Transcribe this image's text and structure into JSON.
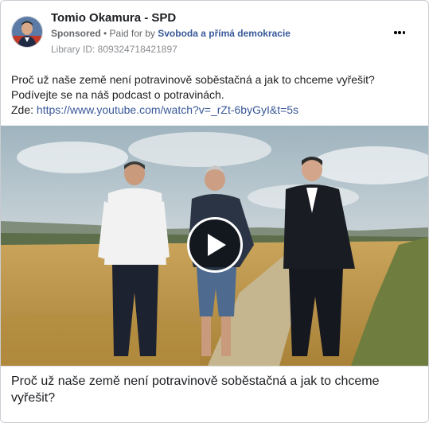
{
  "ad": {
    "page_name": "Tomio Okamura - SPD",
    "sponsored_label": "Sponsored",
    "paid_for_prefix": " • Paid for by ",
    "payer": "Svoboda a přímá demokracie",
    "library_id": "Library ID: 809324718421897"
  },
  "post": {
    "text": "Proč už naše země není potravinově soběstačná a jak to chceme vyřešit? Podívejte se na náš podcast o potravinách.",
    "link_prefix": "Zde: ",
    "link_url": "https://www.youtube.com/watch?v=_rZt-6byGyI&t=5s"
  },
  "media": {
    "type": "video",
    "play_icon": "play-icon",
    "caption": "Proč už naše země není potravinově soběstačná a jak to chceme vyřešit?"
  },
  "icons": {
    "more": "more-options-icon",
    "avatar": "profile-avatar"
  },
  "colors": {
    "link": "#385898",
    "secondary_text": "#65676b",
    "border": "#c9ccd1"
  }
}
